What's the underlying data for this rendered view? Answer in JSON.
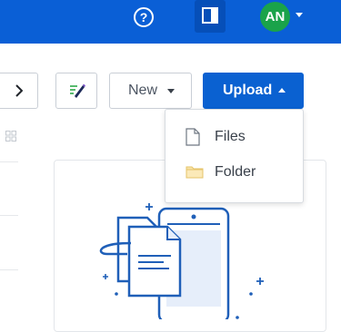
{
  "header": {
    "help_icon": "help-circle-icon",
    "panel_icon": "side-panel-icon",
    "avatar_initials": "AN",
    "avatar_color": "#1aa34a",
    "bar_color": "#0a5fd6"
  },
  "toolbar": {
    "next_icon": "chevron-right-icon",
    "edit_icon": "pencil-lines-icon",
    "new_label": "New",
    "upload_label": "Upload"
  },
  "upload_menu": {
    "items": [
      {
        "label": "Files",
        "icon": "file-icon"
      },
      {
        "label": "Folder",
        "icon": "folder-icon"
      }
    ]
  }
}
